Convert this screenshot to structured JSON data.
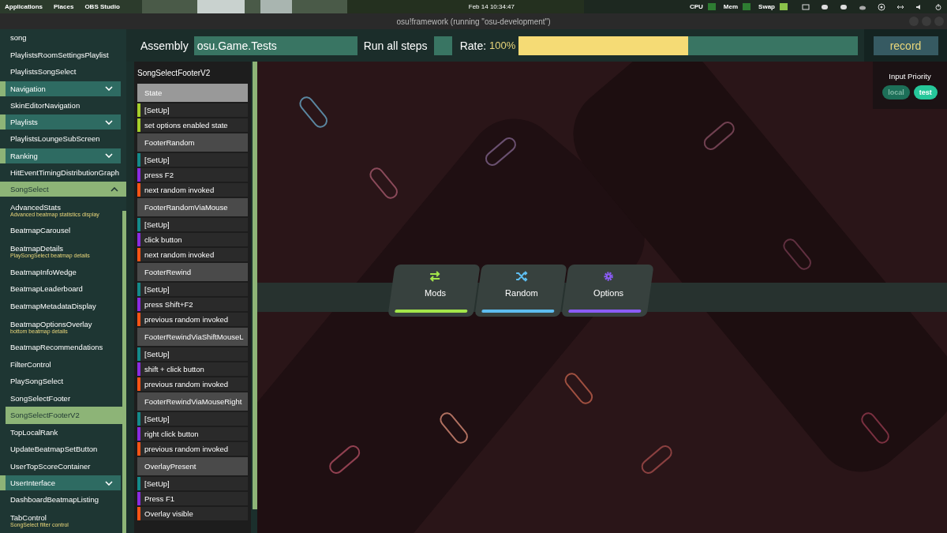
{
  "system_bar": {
    "menus": [
      "Applications",
      "Places",
      "OBS Studio"
    ],
    "clock": "Feb 14  10:34:47",
    "monitors": [
      {
        "label": "CPU",
        "color": "#2e7d32"
      },
      {
        "label": "Mem",
        "color": "#2e7d32"
      },
      {
        "label": "Swap",
        "color": "#8bc34a"
      }
    ]
  },
  "window": {
    "title": "osu!framework (running \"osu-development\")"
  },
  "sidebar": {
    "items": [
      {
        "kind": "test",
        "label": "song",
        "selected": false
      },
      {
        "kind": "test",
        "label": "PlaylistsRoomSettingsPlaylist",
        "selected": false
      },
      {
        "kind": "test",
        "label": "PlaylistsSongSelect",
        "selected": false
      },
      {
        "kind": "group",
        "label": "Navigation",
        "expanded": false
      },
      {
        "kind": "test",
        "label": "SkinEditorNavigation",
        "selected": false
      },
      {
        "kind": "group",
        "label": "Playlists",
        "expanded": false
      },
      {
        "kind": "test",
        "label": "PlaylistsLoungeSubScreen",
        "selected": false
      },
      {
        "kind": "group",
        "label": "Ranking",
        "expanded": false
      },
      {
        "kind": "test",
        "label": "HitEventTimingDistributionGraph",
        "selected": false
      },
      {
        "kind": "group",
        "label": "SongSelect",
        "expanded": true
      },
      {
        "kind": "test",
        "label": "AdvancedStats",
        "description": "Advanced beatmap statistics display",
        "selected": false
      },
      {
        "kind": "test",
        "label": "BeatmapCarousel",
        "selected": false
      },
      {
        "kind": "test",
        "label": "BeatmapDetails",
        "description": "PlaySongSelect beatmap details",
        "selected": false
      },
      {
        "kind": "test",
        "label": "BeatmapInfoWedge",
        "selected": false
      },
      {
        "kind": "test",
        "label": "BeatmapLeaderboard",
        "selected": false
      },
      {
        "kind": "test",
        "label": "BeatmapMetadataDisplay",
        "selected": false
      },
      {
        "kind": "test",
        "label": "BeatmapOptionsOverlay",
        "description": "bottom beatmap details",
        "selected": false
      },
      {
        "kind": "test",
        "label": "BeatmapRecommendations",
        "selected": false
      },
      {
        "kind": "test",
        "label": "FilterControl",
        "selected": false
      },
      {
        "kind": "test",
        "label": "PlaySongSelect",
        "selected": false
      },
      {
        "kind": "test",
        "label": "SongSelectFooter",
        "selected": false
      },
      {
        "kind": "test",
        "label": "SongSelectFooterV2",
        "selected": true
      },
      {
        "kind": "test",
        "label": "TopLocalRank",
        "selected": false
      },
      {
        "kind": "test",
        "label": "UpdateBeatmapSetButton",
        "selected": false
      },
      {
        "kind": "test",
        "label": "UserTopScoreContainer",
        "selected": false
      },
      {
        "kind": "group",
        "label": "UserInterface",
        "expanded": false
      },
      {
        "kind": "test",
        "label": "DashboardBeatmapListing",
        "selected": false
      },
      {
        "kind": "test",
        "label": "TabControl",
        "description": "SongSelect filter control",
        "selected": false
      }
    ]
  },
  "toolbar": {
    "assembly_label": "Assembly",
    "assembly": "osu.Game.Tests",
    "run_all": "Run all steps",
    "rate_label": "Rate:",
    "rate": "100%",
    "rate_slider": {
      "level": 0.5
    },
    "record": "record"
  },
  "steps": {
    "title": "SongSelectFooterV2",
    "items": [
      {
        "kind": "header",
        "label": "State",
        "selected": true
      },
      {
        "kind": "step",
        "label": "[SetUp]",
        "color": "#a5cf2a"
      },
      {
        "kind": "step",
        "label": "set options enabled state",
        "color": "#a5cf2a"
      },
      {
        "kind": "header",
        "label": "FooterRandom",
        "selected": false
      },
      {
        "kind": "step",
        "label": "[SetUp]",
        "color": "#138a8a"
      },
      {
        "kind": "step",
        "label": "press F2",
        "color": "#8a2be2"
      },
      {
        "kind": "step",
        "label": "next random invoked",
        "color": "#ff5414"
      },
      {
        "kind": "header",
        "label": "FooterRandomViaMouse",
        "selected": false
      },
      {
        "kind": "step",
        "label": "[SetUp]",
        "color": "#138a8a"
      },
      {
        "kind": "step",
        "label": "click button",
        "color": "#8a2be2"
      },
      {
        "kind": "step",
        "label": "next random invoked",
        "color": "#ff5414"
      },
      {
        "kind": "header",
        "label": "FooterRewind",
        "selected": false
      },
      {
        "kind": "step",
        "label": "[SetUp]",
        "color": "#138a8a"
      },
      {
        "kind": "step",
        "label": "press Shift+F2",
        "color": "#8a2be2"
      },
      {
        "kind": "step",
        "label": "previous random invoked",
        "color": "#ff5414"
      },
      {
        "kind": "header",
        "label": "FooterRewindViaShiftMouseL",
        "selected": false
      },
      {
        "kind": "step",
        "label": "[SetUp]",
        "color": "#138a8a"
      },
      {
        "kind": "step",
        "label": "shift + click button",
        "color": "#8a2be2"
      },
      {
        "kind": "step",
        "label": "previous random invoked",
        "color": "#ff5414"
      },
      {
        "kind": "header",
        "label": "FooterRewindViaMouseRight",
        "selected": false
      },
      {
        "kind": "step",
        "label": "[SetUp]",
        "color": "#138a8a"
      },
      {
        "kind": "step",
        "label": "right click button",
        "color": "#8a2be2"
      },
      {
        "kind": "step",
        "label": "previous random invoked",
        "color": "#ff5414"
      },
      {
        "kind": "header",
        "label": "OverlayPresent",
        "selected": false
      },
      {
        "kind": "step",
        "label": "[SetUp]",
        "color": "#138a8a"
      },
      {
        "kind": "step",
        "label": "Press F1",
        "color": "#8a2be2"
      },
      {
        "kind": "step",
        "label": "Overlay visible",
        "color": "#ff5414"
      }
    ]
  },
  "input_priority": {
    "title": "Input Priority",
    "options": [
      {
        "label": "local",
        "selected": false
      },
      {
        "label": "test",
        "selected": true
      }
    ]
  },
  "footer_buttons": [
    {
      "kind": "mods",
      "label": "Mods",
      "color": "#a3e64a"
    },
    {
      "kind": "random",
      "label": "Random",
      "color": "#5ebdf0"
    },
    {
      "kind": "options",
      "label": "Options",
      "color": "#8b5cf6"
    }
  ]
}
